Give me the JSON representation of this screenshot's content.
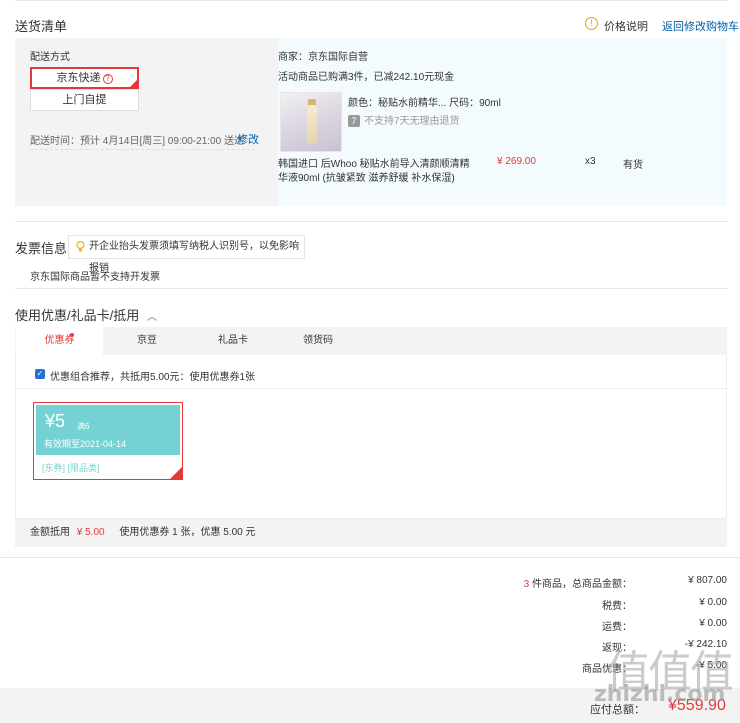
{
  "shipping_list": {
    "title": "送货清单",
    "price_note": "价格说明",
    "back_to_cart": "返回修改购物车"
  },
  "delivery": {
    "method_label": "配送方式",
    "option_jd": "京东快递",
    "option_pickup": "上门自提",
    "time_label": "配送时间：",
    "time_value": "预计 4月14日[周三] 09:00-21:00 送达",
    "modify": "修改"
  },
  "merchant": {
    "name": "商家：京东国际自营",
    "promo": "活动商品已购满3件，已减242.10元现金",
    "spec": "颜色：秘贴水前精华... 尺码：90ml",
    "no_return_icon": "7",
    "no_return": "不支持7天无理由退货",
    "product_name_1": "韩国进口 后Whoo 秘贴水前导入清颜顺清精",
    "product_name_2": "华液90ml (抗皱紧致 滋养舒缓 补水保湿)",
    "price": "¥ 269.00",
    "qty": "x3",
    "stock": "有货"
  },
  "invoice": {
    "title": "发票信息",
    "tip": "开企业抬头发票须填写纳税人识别号，以免影响报销",
    "note": "京东国际商品暂不支持开发票"
  },
  "coupons": {
    "title": "使用优惠/礼品卡/抵用",
    "tabs": [
      "优惠券",
      "京豆",
      "礼品卡",
      "领货码"
    ],
    "recommend": "优惠组合推荐，共抵用5.00元：使用优惠券1张",
    "coupon": {
      "amount": "¥5",
      "condition": "满6",
      "expiry": "有效期至2021-04-14",
      "type": "[东券] [限品类]"
    },
    "footer_label": "金额抵用",
    "footer_amount": "¥ 5.00",
    "footer_detail": "使用优惠券 1 张，优惠 5.00 元"
  },
  "totals": {
    "count": "3",
    "items_label": "件商品，总商品金额：",
    "items_value": "¥ 807.00",
    "tax_label": "税费：",
    "tax_value": "¥ 0.00",
    "freight_label": "运费：",
    "freight_value": "¥ 0.00",
    "discount_label": "返现：",
    "discount_value": "-¥ 242.10",
    "coupon_label": "商品优惠：",
    "coupon_value": "-¥ 5.00",
    "payable_label": "应付总额：",
    "payable_value": "¥559.90"
  },
  "watermark": {
    "glyphs": "值值值",
    "text": "zhizhi.com"
  },
  "colors": {
    "accent_red": "#e4393c",
    "link_blue": "#005ea7",
    "coupon_teal": "#74d2d4"
  }
}
